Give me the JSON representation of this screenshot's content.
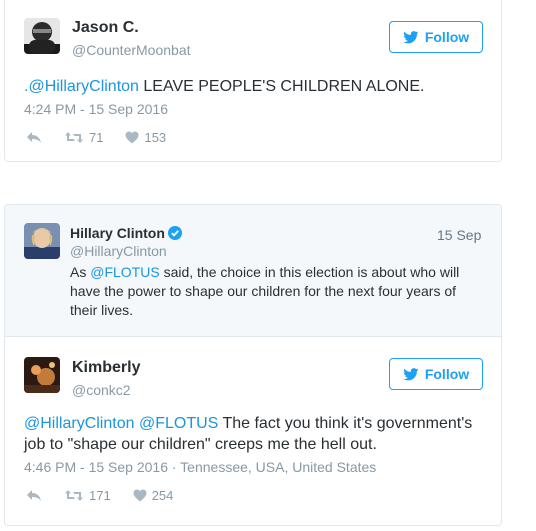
{
  "tweet1": {
    "name": "Jason C.",
    "handle": "@CounterMoonbat",
    "follow_label": "Follow",
    "text_mention": ".@HillaryClinton",
    "text_body": " LEAVE PEOPLE'S CHILDREN ALONE.",
    "timestamp": "4:24 PM - 15 Sep 2016",
    "retweets": "71",
    "likes": "153"
  },
  "quoted": {
    "name": "Hillary Clinton",
    "handle": "@HillaryClinton",
    "date": "15 Sep",
    "text_prefix": "As ",
    "text_mention": "@FLOTUS",
    "text_body": " said, the choice in this election is about who will have the power to shape our children for the next four years of their lives."
  },
  "tweet2": {
    "name": "Kimberly",
    "handle": "@conkc2",
    "follow_label": "Follow",
    "text_mention1": "@HillaryClinton",
    "text_mention2": "@FLOTUS",
    "text_body": " The fact you think it's government's job to \"shape our children\" creeps me the hell out.",
    "timestamp": "4:46 PM - 15 Sep 2016 · Tennessee, USA, United States",
    "retweets": "171",
    "likes": "254"
  },
  "colors": {
    "accent": "#1da1f2",
    "mention": "#1b95e0",
    "muted": "#8899a6",
    "verified": "#1da1f2"
  }
}
